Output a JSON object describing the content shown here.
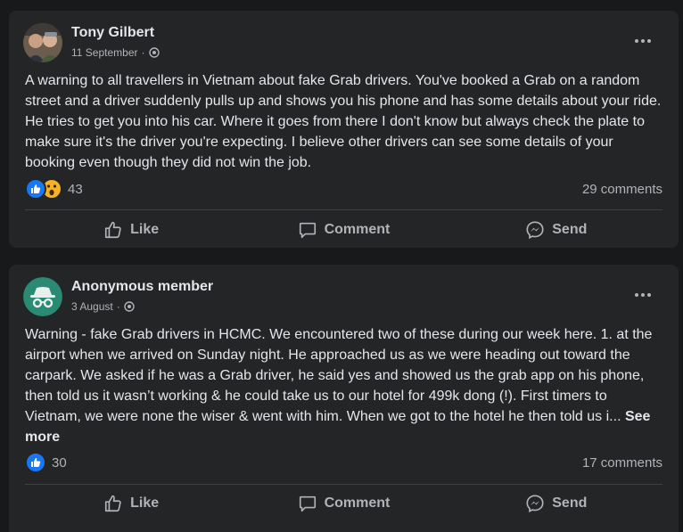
{
  "posts": [
    {
      "author": "Tony Gilbert",
      "date": "11 September",
      "separator": "·",
      "privacy_icon": "globe-icon",
      "text": "A warning to all travellers in Vietnam about fake Grab drivers. You've booked a Grab on a random street and a driver suddenly pulls up and shows you his phone and has some details about your ride. He tries to get you into his car. Where it goes from there I don't know but always check the plate to make sure it's the driver you're expecting. I believe other drivers can see some details of your booking even though they did not win the job.",
      "see_more": "",
      "reactions": [
        "like",
        "wow"
      ],
      "reaction_count": "43",
      "comments": "29 comments"
    },
    {
      "author": "Anonymous member",
      "date": "3 August",
      "separator": "·",
      "privacy_icon": "globe-icon",
      "text": "Warning - fake Grab drivers in HCMC.  We encountered two of these during our week here.  1. at the airport when we arrived on Sunday night.  He approached us as we were heading out toward the carpark.  We asked if he was a Grab driver, he said yes and showed us the grab app on his phone, then told us it wasn’t working & he could take us to our hotel for 499k dong (!).  First timers to Vietnam, we were none the wiser & went with him.  When we got to the hotel he then told us i... ",
      "see_more": "See more",
      "reactions": [
        "like"
      ],
      "reaction_count": "30",
      "comments": "17 comments"
    }
  ],
  "actions": {
    "like": "Like",
    "comment": "Comment",
    "send": "Send"
  },
  "colors": {
    "background": "#18191a",
    "card": "#242526",
    "text_primary": "#e4e6eb",
    "text_secondary": "#b0b3b8",
    "like_blue": "#1877f2",
    "wow_yellow": "#f7b125",
    "anon_avatar": "#2b8a74"
  }
}
